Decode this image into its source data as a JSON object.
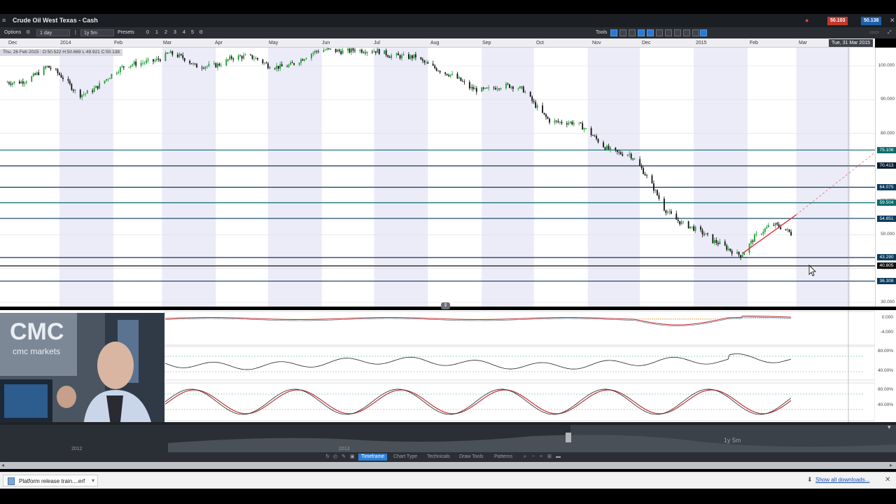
{
  "window": {
    "title": "Crude Oil West Texas - Cash",
    "menu_glyph": "≡",
    "sell_price": "50.103",
    "buy_price": "50.138",
    "colors": {
      "sell": "#c0392b",
      "buy": "#1f5fa8",
      "accent": "#2f80d8"
    }
  },
  "toolbar": {
    "options_label": "Options",
    "interval_label": "1 day",
    "range_label": "1y 5m",
    "presets_label": "Presets",
    "preset_numbers": [
      "0",
      "1",
      "2",
      "3",
      "4",
      "5"
    ],
    "tools_label": "Tools"
  },
  "time_axis": {
    "months": [
      "Dec",
      "2014",
      "Feb",
      "Mar",
      "Apr",
      "May",
      "Jun",
      "Jul",
      "Aug",
      "Sep",
      "Oct",
      "Nov",
      "Dec",
      "2015",
      "Feb",
      "Mar"
    ],
    "crosshair_date": "Tue, 31 Mar 2015"
  },
  "ohlc_readout": "Thu, 26 Feb 2015 : O:50.522 H:50.669 L:49.921 C:50.138",
  "chart_data": {
    "type": "candlestick",
    "instrument": "Crude Oil West Texas - Cash",
    "interval": "1 day",
    "x_range": [
      "2013-12-01",
      "2015-03-31"
    ],
    "ylim": [
      30,
      105
    ],
    "y_ticks": [
      100.0,
      90.0,
      80.0,
      70.0,
      60.0,
      50.0,
      40.0,
      30.0
    ],
    "tick_labels": [
      "100.000",
      "90.000",
      "80.000",
      "70.000",
      "60.000",
      "50.000",
      "40.000",
      "30.000"
    ],
    "close_path": [
      {
        "x": "2013-12-01",
        "y": 95
      },
      {
        "x": "2013-12-25",
        "y": 99
      },
      {
        "x": "2014-01-12",
        "y": 92
      },
      {
        "x": "2014-02-01",
        "y": 97
      },
      {
        "x": "2014-02-20",
        "y": 102
      },
      {
        "x": "2014-03-05",
        "y": 104
      },
      {
        "x": "2014-03-20",
        "y": 99
      },
      {
        "x": "2014-04-10",
        "y": 103
      },
      {
        "x": "2014-05-01",
        "y": 100
      },
      {
        "x": "2014-05-20",
        "y": 102
      },
      {
        "x": "2014-06-20",
        "y": 106
      },
      {
        "x": "2014-07-10",
        "y": 102
      },
      {
        "x": "2014-07-25",
        "y": 104
      },
      {
        "x": "2014-08-10",
        "y": 97
      },
      {
        "x": "2014-08-25",
        "y": 94
      },
      {
        "x": "2014-09-10",
        "y": 94
      },
      {
        "x": "2014-09-25",
        "y": 92
      },
      {
        "x": "2014-10-10",
        "y": 85
      },
      {
        "x": "2014-10-25",
        "y": 82
      },
      {
        "x": "2014-11-10",
        "y": 77
      },
      {
        "x": "2014-11-25",
        "y": 74
      },
      {
        "x": "2014-12-05",
        "y": 66
      },
      {
        "x": "2014-12-15",
        "y": 58
      },
      {
        "x": "2014-12-30",
        "y": 53
      },
      {
        "x": "2015-01-12",
        "y": 47
      },
      {
        "x": "2015-01-28",
        "y": 45
      },
      {
        "x": "2015-02-05",
        "y": 50
      },
      {
        "x": "2015-02-15",
        "y": 52
      },
      {
        "x": "2015-02-26",
        "y": 50.1
      }
    ],
    "horizontal_levels": [
      {
        "label": "75.106",
        "value": 75.106,
        "color": "#0b6b6b"
      },
      {
        "label": "70.413",
        "value": 70.413,
        "color": "#0b1f33"
      },
      {
        "label": "64.075",
        "value": 64.075,
        "color": "#0b3a5c"
      },
      {
        "label": "59.504",
        "value": 59.504,
        "color": "#0b6b6b"
      },
      {
        "label": "54.851",
        "value": 54.851,
        "color": "#0b3a5c"
      },
      {
        "label": "43.290",
        "value": 43.29,
        "color": "#0b3a5c"
      },
      {
        "label": "40.805",
        "value": 40.805,
        "color": "#111111"
      },
      {
        "label": "36.308",
        "value": 36.308,
        "color": "#0b3a5c"
      }
    ],
    "trendline": {
      "from": {
        "x": "2015-01-29",
        "y": 44.5
      },
      "to": {
        "x": "2015-03-31",
        "y": 67
      },
      "color": "#e0303a"
    },
    "indicators": [
      {
        "name": "MACD",
        "tick_labels": [
          "0.000",
          "-4.000"
        ]
      },
      {
        "name": "RSI",
        "tick_labels": [
          "80.00%",
          "40.00%"
        ]
      },
      {
        "name": "Stochastic",
        "tick_labels": [
          "80.00%",
          "40.00%"
        ]
      }
    ]
  },
  "navigator": {
    "year_labels": [
      "2012",
      "2013"
    ],
    "range_label": "1y 5m"
  },
  "bottom_tabs": [
    "Timeframe",
    "Chart Type",
    "Technicals",
    "Draw Tools",
    "Patterns"
  ],
  "downloads": {
    "file_name": "Platform release train....erf",
    "caret": "▾",
    "show_all": "Show all downloads...",
    "close": "✕"
  },
  "webcam": {
    "logo_text": "CMC",
    "logo_sub": "cmc markets"
  }
}
